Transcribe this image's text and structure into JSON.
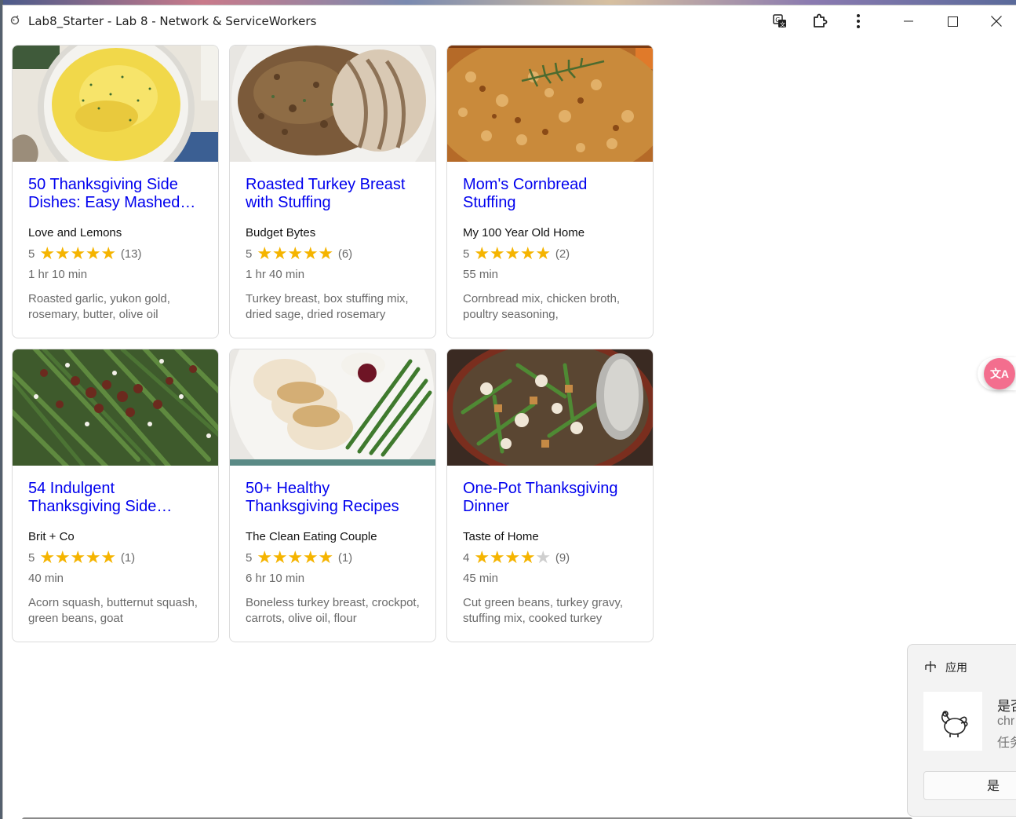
{
  "window": {
    "title": "Lab8_Starter - Lab 8 - Network & ServiceWorkers",
    "toolbar_icons": [
      "translate-icon",
      "extensions-icon",
      "more-vert-icon"
    ],
    "controls": [
      "minimize-icon",
      "maximize-icon",
      "close-icon"
    ]
  },
  "recipes": [
    {
      "title": "50 Thanksgiving Side Dishes: Easy Mashed…",
      "org": "Love and Lemons",
      "rating": "5",
      "stars": 5,
      "count": "(13)",
      "time": "1 hr 10 min",
      "ingredients": "Roasted garlic, yukon gold, rosemary, butter, olive oil",
      "image": "mashed-potatoes"
    },
    {
      "title": "Roasted Turkey Breast with Stuffing",
      "org": "Budget Bytes",
      "rating": "5",
      "stars": 5,
      "count": "(6)",
      "time": "1 hr 40 min",
      "ingredients": "Turkey breast, box stuffing mix, dried sage, dried rosemary",
      "image": "turkey-stuffing"
    },
    {
      "title": "Mom's Cornbread Stuffing",
      "org": "My 100 Year Old Home",
      "rating": "5",
      "stars": 5,
      "count": "(2)",
      "time": "55 min",
      "ingredients": "Cornbread mix, chicken broth, poultry seasoning,",
      "image": "cornbread-stuffing"
    },
    {
      "title": "54 Indulgent Thanksgiving Side…",
      "org": "Brit + Co",
      "rating": "5",
      "stars": 5,
      "count": "(1)",
      "time": "40 min",
      "ingredients": "Acorn squash, butternut squash, green beans, goat",
      "image": "green-beans"
    },
    {
      "title": "50+ Healthy Thanksgiving Recipes",
      "org": "The Clean Eating Couple",
      "rating": "5",
      "stars": 5,
      "count": "(1)",
      "time": "6 hr 10 min",
      "ingredients": "Boneless turkey breast, crockpot, carrots, olive oil, flour",
      "image": "turkey-plate"
    },
    {
      "title": "One-Pot Thanksgiving Dinner",
      "org": "Taste of Home",
      "rating": "4",
      "stars": 4,
      "count": "(9)",
      "time": "45 min",
      "ingredients": "Cut green beans, turkey gravy, stuffing mix, cooked turkey",
      "image": "one-pot-dinner"
    }
  ],
  "translate_widget": {
    "label": "文A"
  },
  "toast": {
    "app_label": "应用",
    "line1": "是否",
    "line2": "chr",
    "line3": "任务",
    "button": "是"
  },
  "colors": {
    "link": "#0000ee",
    "star": "#f5b400",
    "star_off": "#cfcfcf",
    "muted": "#6a6a6a"
  }
}
